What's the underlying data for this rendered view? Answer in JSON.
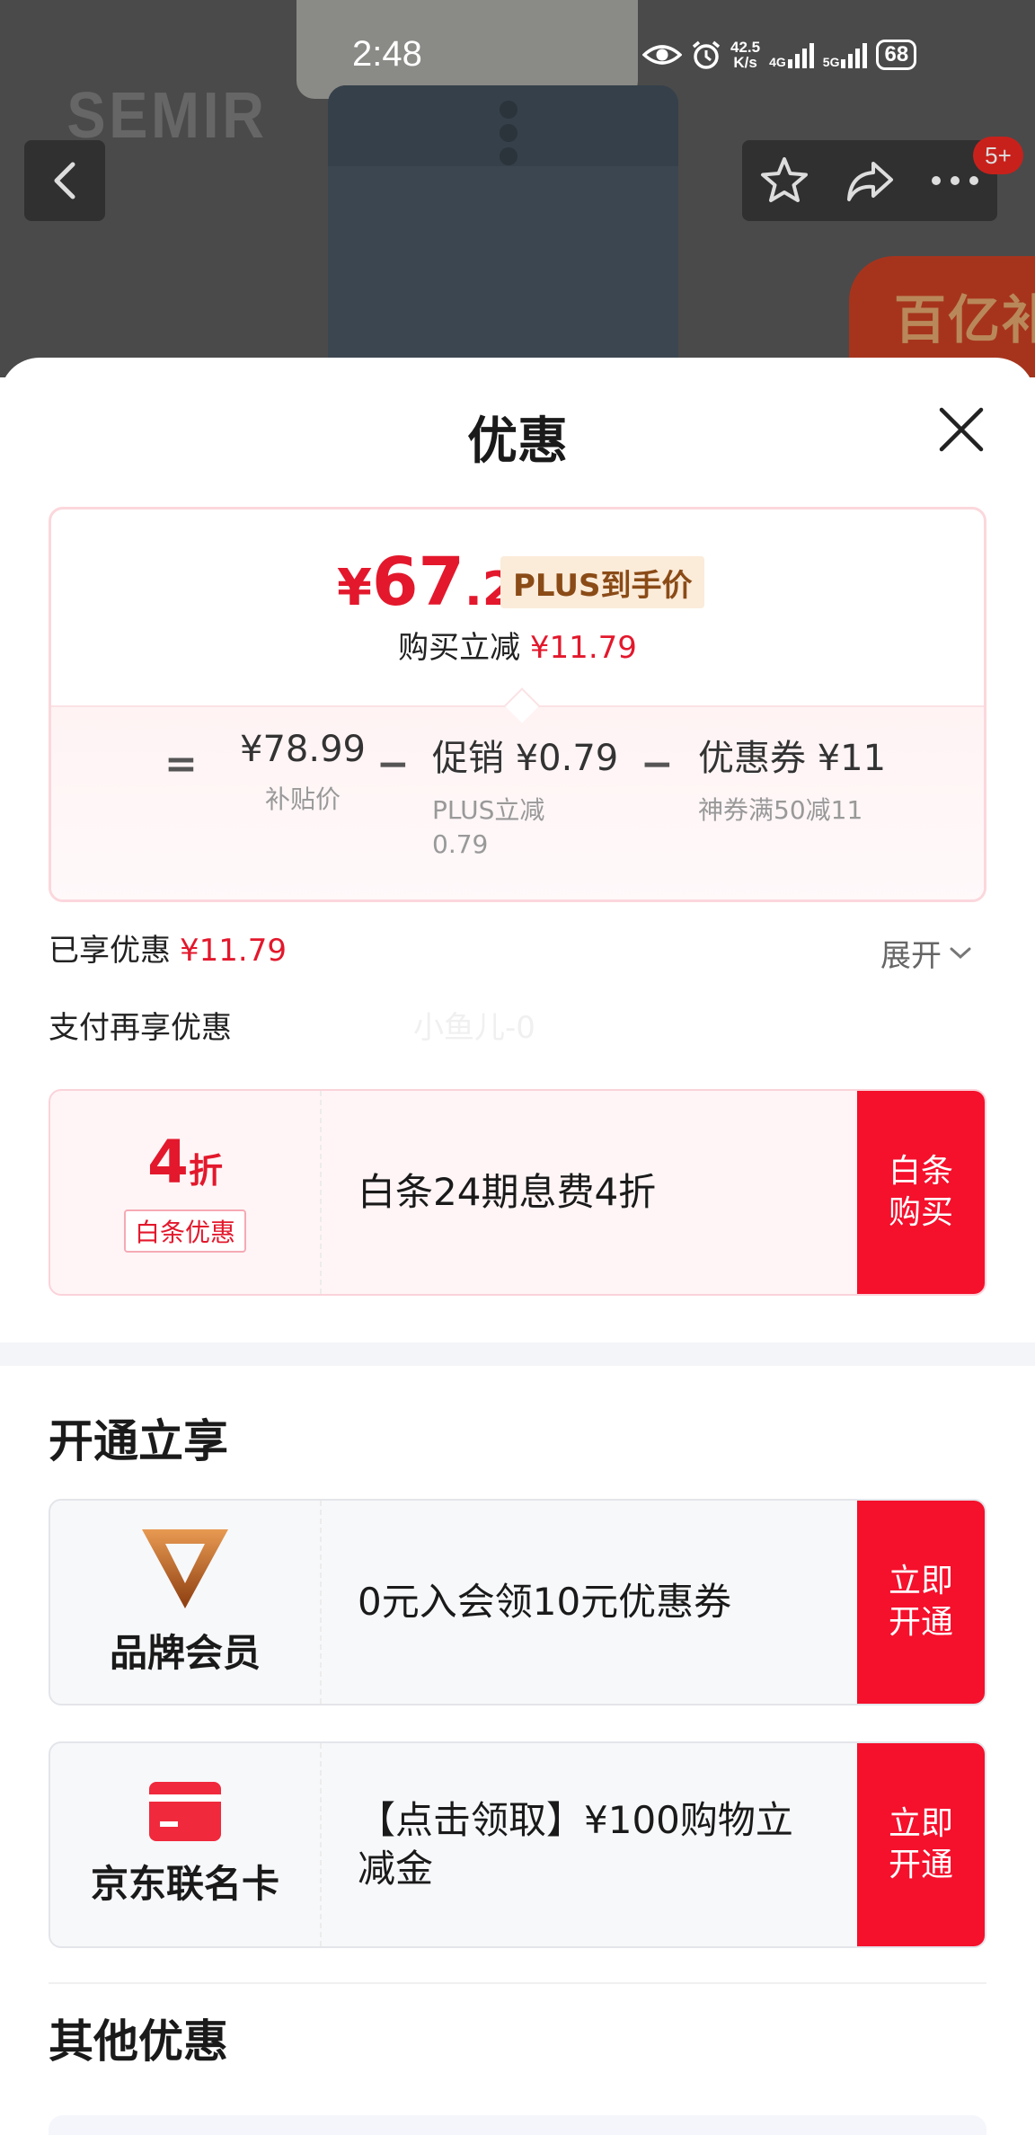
{
  "status_bar": {
    "time": "2:48",
    "net_speed_value": "42.5",
    "net_speed_unit": "K/s",
    "net_type_1": "4G",
    "net_type_2": "5G",
    "battery": "68"
  },
  "backdrop": {
    "brand_logo": "SEMIR",
    "sticker_text": "百亿补贴",
    "notification_badge": "5+"
  },
  "sheet": {
    "title": "优惠"
  },
  "price_summary": {
    "currency": "¥",
    "final_int": "67",
    "final_dec": ".2",
    "final_tag": "PLUS到手价",
    "instant_label": "购买立减",
    "instant_value": "¥11.79",
    "eq_sign": "=",
    "minus_sign": "−",
    "base": {
      "value": "¥78.99",
      "label": "补贴价"
    },
    "promo": {
      "value": "促销 ¥0.79",
      "label": "PLUS立减0.79"
    },
    "coupon": {
      "value": "优惠券 ¥11",
      "label": "神券满50减11"
    }
  },
  "enjoyed": {
    "label": "已享优惠",
    "value": "¥11.79"
  },
  "expand_label": "展开",
  "pay_more_label": "支付再享优惠",
  "watermark": "小鱼儿-0",
  "baitiao_offer": {
    "discount_num": "4",
    "discount_unit": "折",
    "tag": "白条优惠",
    "description": "白条24期息费4折",
    "button": "白条购买"
  },
  "open_section": {
    "title": "开通立享",
    "items": [
      {
        "name": "品牌会员",
        "description": "0元入会领10元优惠券",
        "button": "立即开通",
        "icon": "brand-v-icon"
      },
      {
        "name": "京东联名卡",
        "description": "【点击领取】¥100购物立减金",
        "button": "立即开通",
        "icon": "credit-card-icon"
      }
    ]
  },
  "other_section": {
    "title": "其他优惠"
  },
  "colors": {
    "accent_red": "#e3182c",
    "button_red": "#f5102c",
    "plus_gold": "#8a4b17"
  }
}
